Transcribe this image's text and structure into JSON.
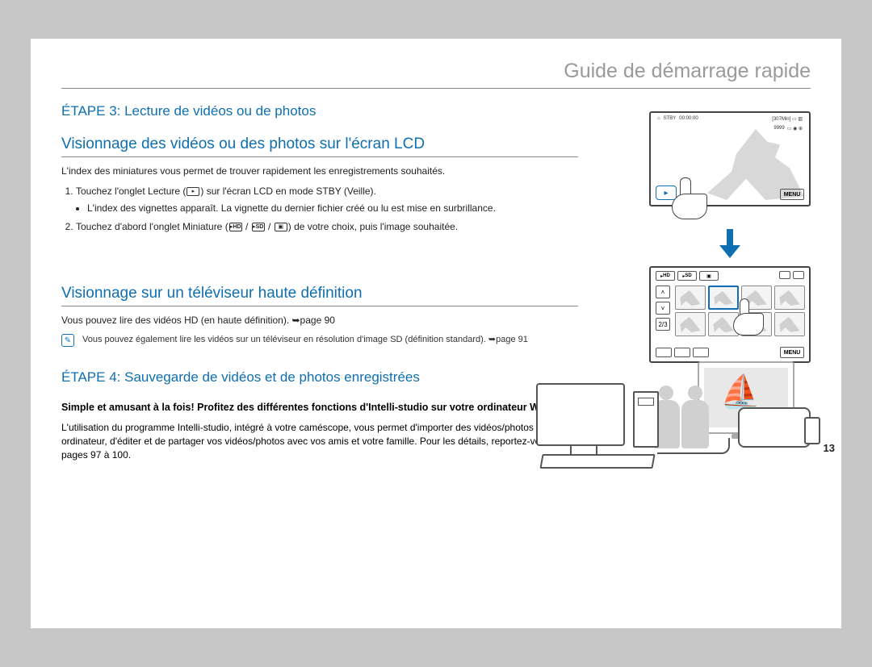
{
  "chapter_title": "Guide de démarrage rapide",
  "page_number": "13",
  "step3": {
    "heading": "ÉTAPE 3: Lecture de vidéos ou de photos",
    "section1": {
      "title": "Visionnage des vidéos ou des photos sur l'écran LCD",
      "intro": "L'index des miniatures vous permet de trouver rapidement les enregistrements souhaités.",
      "li1_a": "Touchez l'onglet Lecture (",
      "li1_b": ") sur l'écran LCD en mode STBY (Veille).",
      "li1_sub": "L'index des vignettes apparaît. La vignette du dernier fichier créé ou lu est mise en surbrillance.",
      "li2_a": "Touchez d'abord l'onglet Miniature (",
      "li2_hd": "HD",
      "li2_sep1": " / ",
      "li2_sd": "SD",
      "li2_sep2": " / ",
      "li2_b": ") de votre choix, puis l'image souhaitée.",
      "icon_play": "▸",
      "icon_photo": "▣"
    },
    "section2": {
      "title": "Visionnage sur un téléviseur haute définition",
      "intro": "Vous pouvez lire des vidéos HD (en haute définition). ➥page 90",
      "note": "Vous pouvez également lire les vidéos sur un téléviseur en résolution d'image SD (définition standard). ➥page 91"
    }
  },
  "step4": {
    "heading": "ÉTAPE 4: Sauvegarde de vidéos et de photos enregistrées",
    "bold_intro": "Simple et amusant à la fois! Profitez des différentes fonctions d'Intelli-studio sur votre ordinateur Windows.",
    "body": "L'utilisation du programme Intelli-studio, intégré à votre caméscope, vous permet d'importer des vidéos/photos sur votre ordinateur, d'éditer et de partager vos vidéos/photos avec vos amis et votre famille. Pour les détails, reportez-vous aux pages 97 à 100."
  },
  "lcd1": {
    "stby": "STBY",
    "time": "00:00:00",
    "min": "[307Min]",
    "count": "9999",
    "menu": "MENU"
  },
  "lcd2": {
    "tab_hd": "HD",
    "tab_sd": "SD",
    "up": "˄",
    "down": "˅",
    "page": "2/3",
    "menu": "MENU"
  }
}
